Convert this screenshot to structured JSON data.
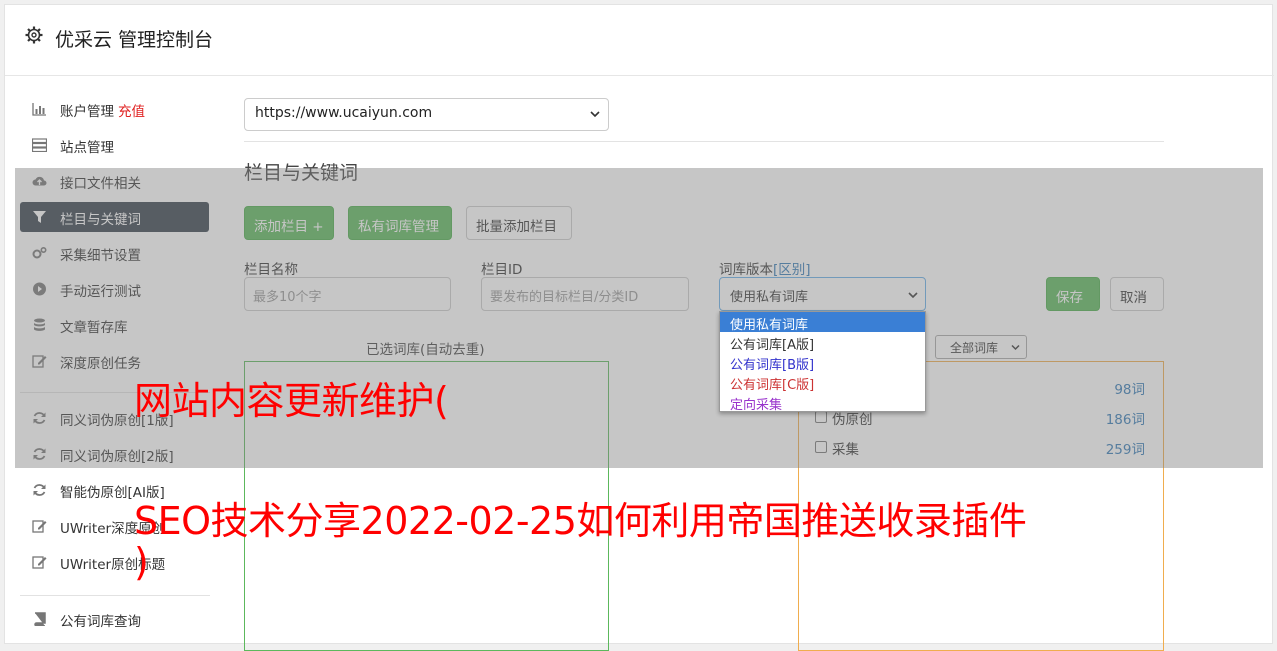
{
  "app": {
    "title": "优采云 管理控制台"
  },
  "sidebar": {
    "items": [
      {
        "label": "账户管理",
        "extra": "充值",
        "icon": "bar-chart-icon"
      },
      {
        "label": "站点管理",
        "icon": "server-icon"
      },
      {
        "label": "接口文件相关",
        "icon": "cloud-upload-icon"
      },
      {
        "label": "栏目与关键词",
        "icon": "filter-icon"
      },
      {
        "label": "采集细节设置",
        "icon": "cogs-icon"
      },
      {
        "label": "手动运行测试",
        "icon": "play-circle-icon"
      },
      {
        "label": "文章暂存库",
        "icon": "database-icon"
      },
      {
        "label": "深度原创任务",
        "icon": "edit-icon"
      },
      {
        "label": "同义词伪原创[1版]",
        "icon": "refresh-icon"
      },
      {
        "label": "同义词伪原创[2版]",
        "icon": "refresh-icon"
      },
      {
        "label": "智能伪原创[AI版]",
        "icon": "refresh-icon"
      },
      {
        "label": "UWriter深度原创",
        "icon": "edit-icon"
      },
      {
        "label": "UWriter原创标题",
        "icon": "edit-icon"
      },
      {
        "label": "公有词库查询",
        "icon": "book-icon"
      }
    ]
  },
  "main": {
    "site_select_value": "https://www.ucaiyun.com",
    "section_title": "栏目与关键词",
    "buttons": {
      "add_column": "添加栏目 +",
      "private_lib": "私有词库管理",
      "batch_add": "批量添加栏目",
      "save": "保存",
      "cancel": "取消"
    },
    "fields": {
      "column_name_label": "栏目名称",
      "column_name_placeholder": "最多10个字",
      "column_id_label": "栏目ID",
      "column_id_placeholder": "要发布的目标栏目/分类ID",
      "version_label": "词库版本",
      "version_link": "[区别]",
      "version_value": "使用私有词库"
    },
    "version_options": [
      {
        "label": "使用私有词库",
        "color": "#ffffff",
        "bg": "#3a7fd5"
      },
      {
        "label": "公有词库[A版]",
        "color": "#333333"
      },
      {
        "label": "公有词库[B版]",
        "color": "#3333cc"
      },
      {
        "label": "公有词库[C版]",
        "color": "#cc3333"
      },
      {
        "label": "定向采集",
        "color": "#9933cc"
      }
    ],
    "selected_caption": "已选词库(自动去重)",
    "lib_filter_value": "全部词库",
    "lib_rows": [
      {
        "name": "",
        "count": "98词"
      },
      {
        "name": "伪原创",
        "count": "186词"
      },
      {
        "name": "采集",
        "count": "259词"
      }
    ]
  },
  "watermark": {
    "line1": "网站内容更新维护(",
    "line2": "SEO技术分享2022-02-25如何利用帝国推送收录插件",
    "line3": ")"
  }
}
